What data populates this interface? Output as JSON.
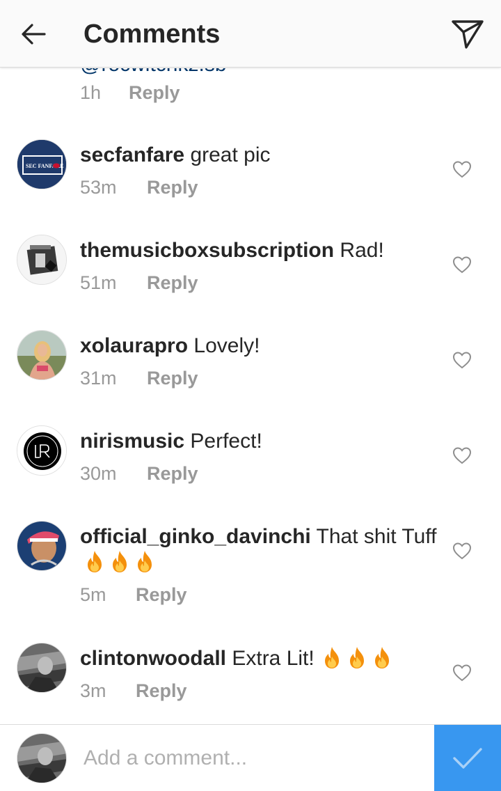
{
  "header": {
    "title": "Comments",
    "back_icon": "arrow-left-icon",
    "send_icon": "paper-plane-icon"
  },
  "partial_comment": {
    "text": "@rocwitchkz.sb",
    "time": "1h",
    "reply": "Reply"
  },
  "comments": [
    {
      "username": "secfanfare",
      "text": "great pic",
      "time": "53m",
      "reply": "Reply"
    },
    {
      "username": "themusicboxsubscription",
      "text": "Rad!",
      "time": "51m",
      "reply": "Reply"
    },
    {
      "username": "xolaurapro",
      "text": "Lovely!",
      "time": "31m",
      "reply": "Reply"
    },
    {
      "username": "nirismusic",
      "text": "Perfect!",
      "time": "30m",
      "reply": "Reply"
    },
    {
      "username": "official_ginko_davinchi",
      "text": "That shit Tuff",
      "time": "5m",
      "reply": "Reply"
    },
    {
      "username": "clintonwoodall",
      "text": "Extra Lit!",
      "time": "3m",
      "reply": "Reply"
    }
  ],
  "avatars": {
    "secfanfare_badge": "SEC FANFARE"
  },
  "composer": {
    "placeholder": "Add a comment..."
  },
  "colors": {
    "accent": "#3897f0",
    "header_bg": "#fafafa",
    "muted": "#999999",
    "text": "#262626"
  }
}
